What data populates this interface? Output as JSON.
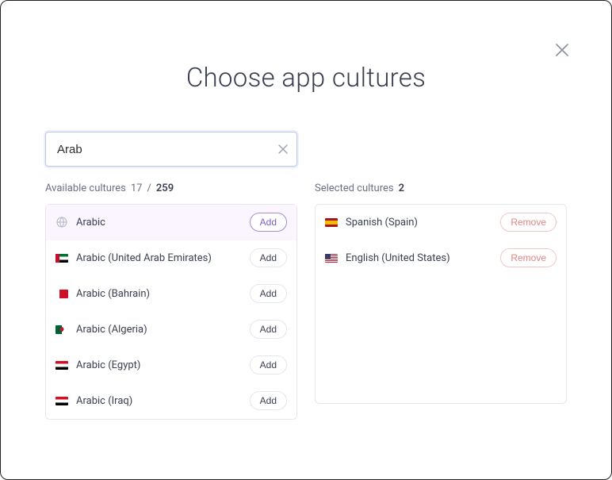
{
  "title": "Choose app cultures",
  "search": {
    "value": "Arab",
    "placeholder": ""
  },
  "available": {
    "header_label": "Available cultures",
    "filtered_count": "17",
    "separator": "/",
    "total_count": "259"
  },
  "selected": {
    "header_label": "Selected cultures",
    "count": "2"
  },
  "buttons": {
    "add": "Add",
    "remove": "Remove"
  },
  "available_items": [
    {
      "label": "Arabic",
      "flag": "globe",
      "highlighted": true
    },
    {
      "label": "Arabic (United Arab Emirates)",
      "flag": "ae"
    },
    {
      "label": "Arabic (Bahrain)",
      "flag": "bh"
    },
    {
      "label": "Arabic (Algeria)",
      "flag": "dz"
    },
    {
      "label": "Arabic (Egypt)",
      "flag": "eg"
    },
    {
      "label": "Arabic (Iraq)",
      "flag": "iq"
    }
  ],
  "selected_items": [
    {
      "label": "Spanish (Spain)",
      "flag": "es"
    },
    {
      "label": "English (United States)",
      "flag": "us"
    }
  ]
}
